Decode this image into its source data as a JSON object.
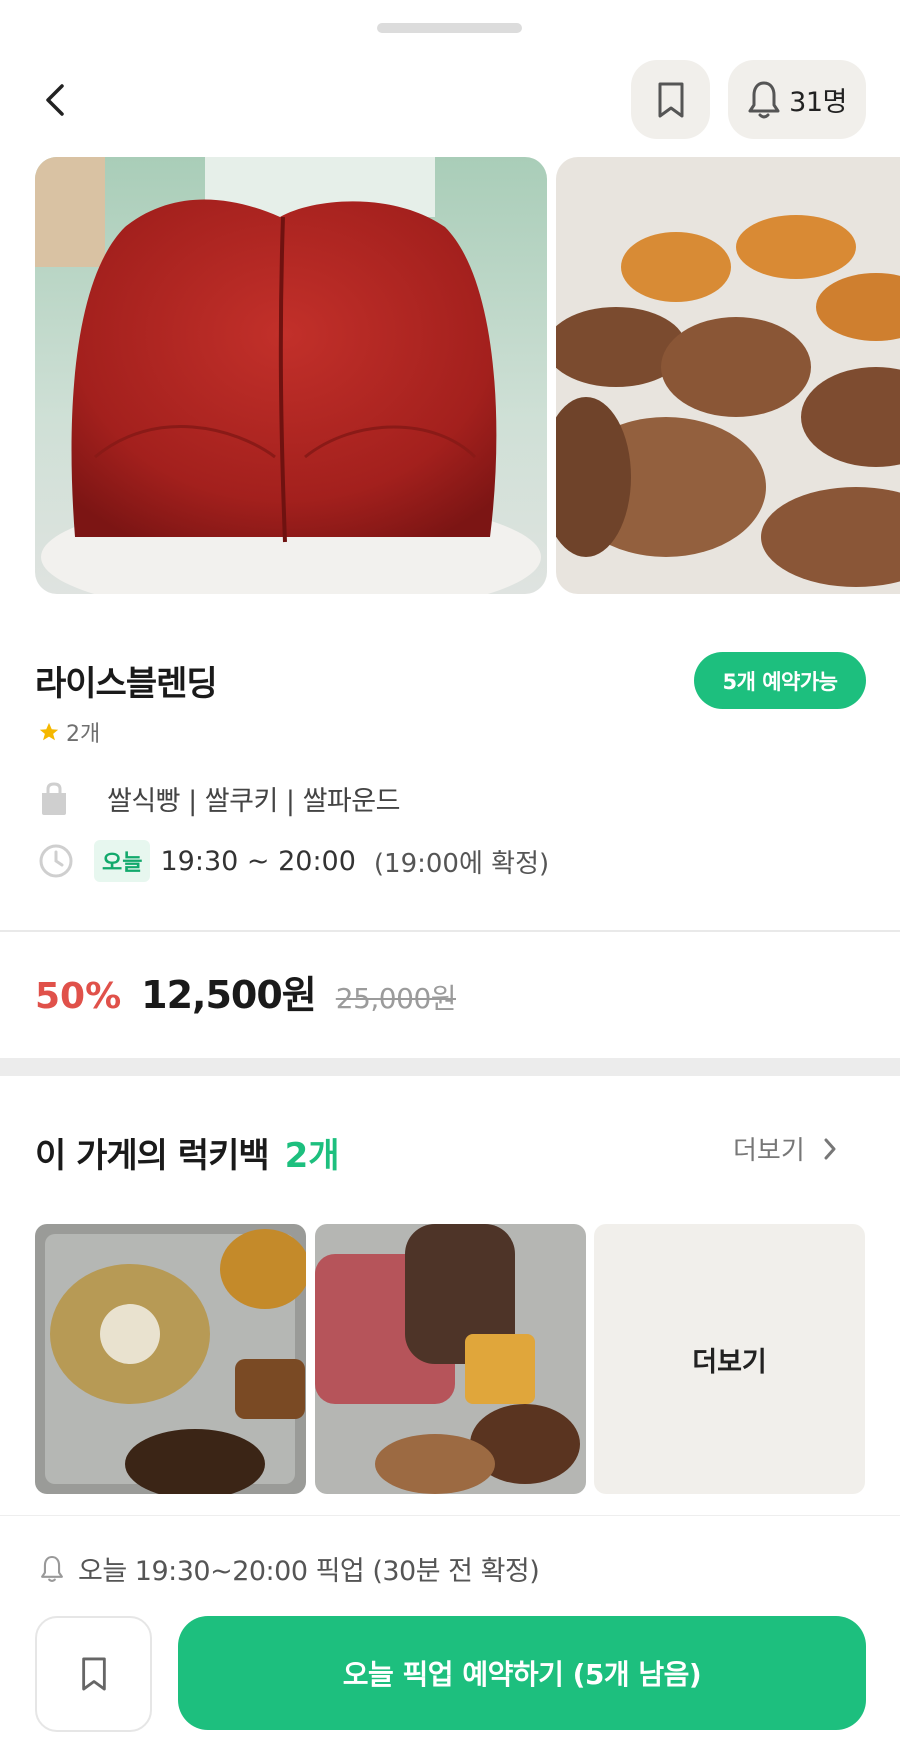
{
  "header": {
    "alarm_count": "31명"
  },
  "store": {
    "name": "라이스블렌딩",
    "availability_badge": "5개 예약가능",
    "rating_count": "2개",
    "menu": "쌀식빵 | 쌀쿠키 | 쌀파운드",
    "pickup_day": "오늘",
    "pickup_time": "19:30 ~ 20:00",
    "confirm_time": "(19:00에 확정)"
  },
  "pricing": {
    "discount": "50%",
    "price": "12,500원",
    "original_price": "25,000원"
  },
  "luckybags": {
    "title": "이 가게의 럭키백",
    "count": "2개",
    "more_link": "더보기",
    "more_tile": "더보기"
  },
  "bottom": {
    "pickup_notice": "오늘 19:30~20:00 픽업 (30분 전 확정)",
    "reserve_button": "오늘 픽업 예약하기 (5개 남음)"
  },
  "colors": {
    "accent": "#1dbf7e",
    "discount": "#e0514a",
    "star": "#f5b800",
    "chip_bg": "#f1efeb"
  },
  "icons": [
    "back-icon",
    "bookmark-icon",
    "bell-icon",
    "star-icon",
    "shopping-bag-icon",
    "clock-icon",
    "chevron-right-icon"
  ]
}
